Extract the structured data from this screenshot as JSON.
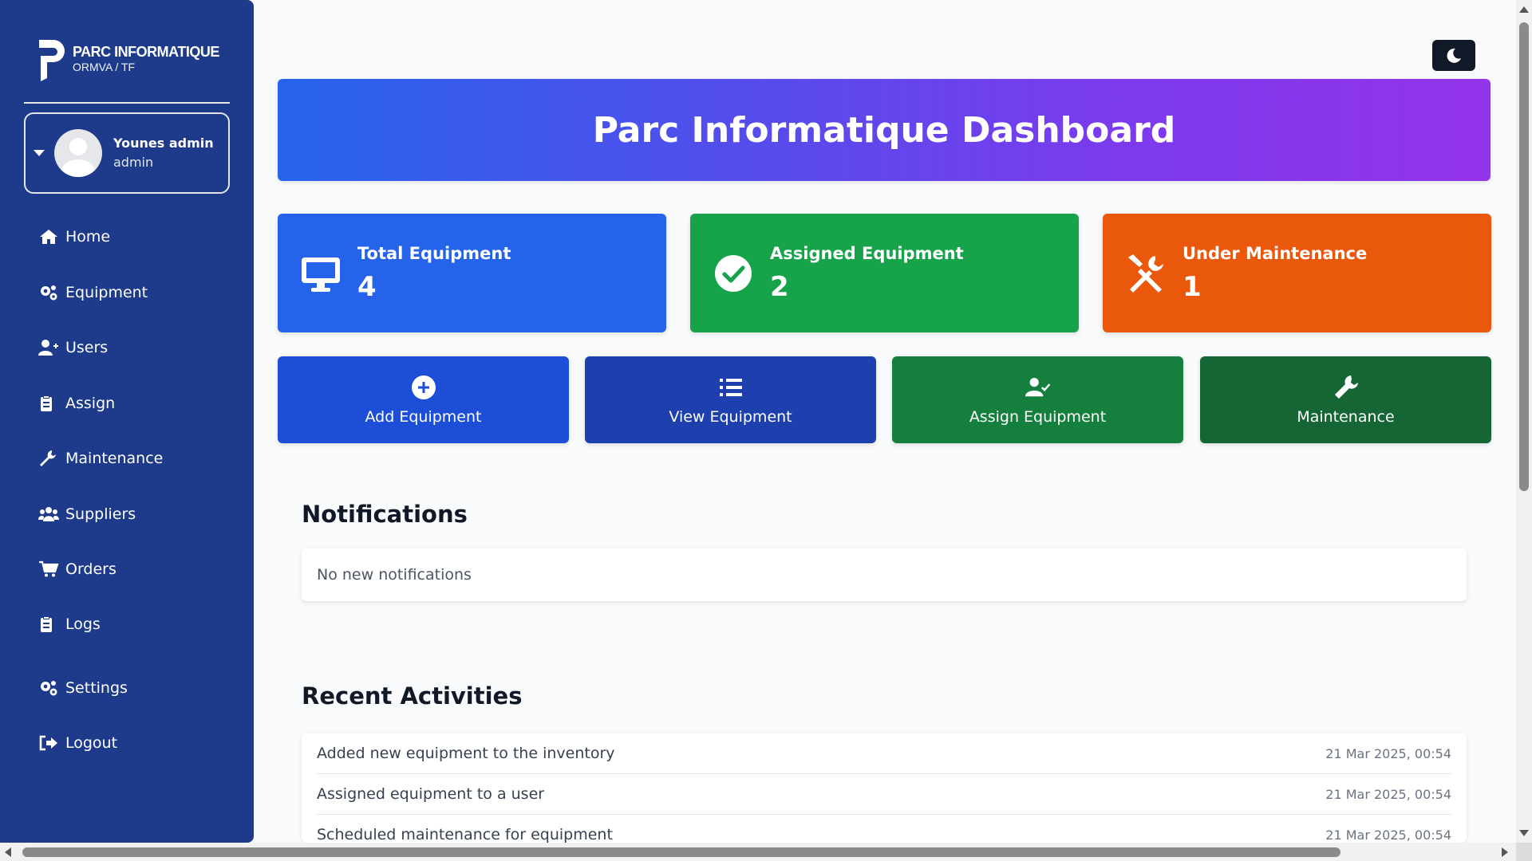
{
  "brand": {
    "title": "PARC INFORMATIQUE",
    "subtitle": "ORMVA / TF"
  },
  "user": {
    "name": "Younes admin",
    "role": "admin"
  },
  "nav": [
    {
      "label": "Home",
      "icon": "home-icon"
    },
    {
      "label": "Equipment",
      "icon": "gears-icon"
    },
    {
      "label": "Users",
      "icon": "user-plus-icon"
    },
    {
      "label": "Assign",
      "icon": "clipboard-icon"
    },
    {
      "label": "Maintenance",
      "icon": "wrench-icon"
    },
    {
      "label": "Suppliers",
      "icon": "users-icon"
    },
    {
      "label": "Orders",
      "icon": "cart-icon"
    },
    {
      "label": "Logs",
      "icon": "clipboard-icon"
    },
    {
      "label": "Settings",
      "icon": "gears-icon"
    },
    {
      "label": "Logout",
      "icon": "logout-icon"
    }
  ],
  "header": {
    "title": "Parc Informatique Dashboard",
    "theme_toggle_icon": "moon-icon"
  },
  "stats": [
    {
      "label": "Total Equipment",
      "value": "4",
      "color": "#2563eb",
      "icon": "desktop-icon"
    },
    {
      "label": "Assigned Equipment",
      "value": "2",
      "color": "#16a34a",
      "icon": "check-circle-icon"
    },
    {
      "label": "Under Maintenance",
      "value": "1",
      "color": "#ea580c",
      "icon": "tools-icon"
    }
  ],
  "actions": [
    {
      "label": "Add Equipment",
      "color": "#1d4ed8",
      "icon": "plus-circle-icon"
    },
    {
      "label": "View Equipment",
      "color": "#1e40af",
      "icon": "list-icon"
    },
    {
      "label": "Assign Equipment",
      "color": "#15803d",
      "icon": "user-check-icon"
    },
    {
      "label": "Maintenance",
      "color": "#166534",
      "icon": "wrench-icon"
    }
  ],
  "notifications": {
    "title": "Notifications",
    "empty_text": "No new notifications"
  },
  "activities": {
    "title": "Recent Activities",
    "items": [
      {
        "text": "Added new equipment to the inventory",
        "date": "21 Mar 2025, 00:54"
      },
      {
        "text": "Assigned equipment to a user",
        "date": "21 Mar 2025, 00:54"
      },
      {
        "text": "Scheduled maintenance for equipment",
        "date": "21 Mar 2025, 00:54"
      }
    ]
  }
}
